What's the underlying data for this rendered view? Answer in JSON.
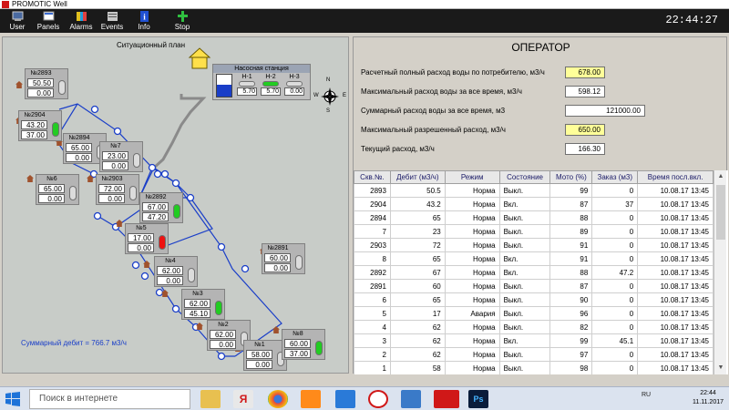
{
  "window": {
    "title": "PROMOTIC Well"
  },
  "toolbar": {
    "buttons": [
      {
        "label": "User",
        "icon": "user-icon"
      },
      {
        "label": "Panels",
        "icon": "panels-icon"
      },
      {
        "label": "Alarms",
        "icon": "alarms-icon"
      },
      {
        "label": "Events",
        "icon": "events-icon"
      },
      {
        "label": "Info",
        "icon": "info-icon"
      },
      {
        "label": "Stop",
        "icon": "stop-icon"
      }
    ],
    "clock": "22:44:27"
  },
  "map": {
    "title": "Ситуационный план",
    "compass": {
      "n": "N",
      "s": "S",
      "e": "E",
      "w": "W"
    },
    "pump_station": {
      "title": "Насосная станция",
      "tank_level": 0.55,
      "tank_value": "5.70",
      "pumps": [
        {
          "name": "Н-1",
          "value": "5.70",
          "on": false
        },
        {
          "name": "Н-2",
          "value": "5.70",
          "on": true
        },
        {
          "name": "Н-3",
          "value": "0.00",
          "on": false
        }
      ]
    },
    "wells": [
      {
        "label": "№2893",
        "debit": "50.50",
        "order": "0.00",
        "state": "off"
      },
      {
        "label": "№2904",
        "debit": "43.20",
        "order": "37.00",
        "state": "on"
      },
      {
        "label": "№2894",
        "debit": "65.00",
        "order": "0.00",
        "state": "off"
      },
      {
        "label": "№7",
        "debit": "23.00",
        "order": "0.00",
        "state": "off"
      },
      {
        "label": "№2903",
        "debit": "72.00",
        "order": "0.00",
        "state": "off"
      },
      {
        "label": "№6",
        "debit": "65.00",
        "order": "0.00",
        "state": "off"
      },
      {
        "label": "№2892",
        "debit": "67.00",
        "order": "47.20",
        "state": "on"
      },
      {
        "label": "№5",
        "debit": "17.00",
        "order": "0.00",
        "state": "alarm"
      },
      {
        "label": "№4",
        "debit": "62.00",
        "order": "0.00",
        "state": "off"
      },
      {
        "label": "№3",
        "debit": "62.00",
        "order": "45.10",
        "state": "on"
      },
      {
        "label": "№2",
        "debit": "62.00",
        "order": "0.00",
        "state": "off"
      },
      {
        "label": "№2891",
        "debit": "60.00",
        "order": "0.00",
        "state": "off"
      },
      {
        "label": "№1",
        "debit": "58.00",
        "order": "0.00",
        "state": "off"
      },
      {
        "label": "№8",
        "debit": "60.00",
        "order": "37.00",
        "state": "on"
      }
    ],
    "summary": "Суммарный дебит = 766.7 м3/ч",
    "colors": {
      "on": "#22cc22",
      "alarm": "#ee1111",
      "off": "#dcdcdc",
      "pipe": "#1a3ec8",
      "valve": "#1a3ec8"
    }
  },
  "operator": {
    "title": "ОПЕРАТОР",
    "rows": [
      {
        "label": "Расчетный полный расход воды по потребителю, м3/ч",
        "value": "678.00",
        "highlight": true
      },
      {
        "label": "Максимальный расход воды за все время, м3/ч",
        "value": "598.12",
        "highlight": false
      },
      {
        "label": "Суммарный расход воды за все время, м3",
        "value": "121000.00",
        "highlight": false
      },
      {
        "label": "Максимальный разрешенный расход, м3/ч",
        "value": "650.00",
        "highlight": true
      },
      {
        "label": "Текущий расход, м3/ч",
        "value": "166.30",
        "highlight": false
      }
    ]
  },
  "table": {
    "headers": [
      "Скв.№.",
      "Дебит (м3/ч)",
      "Режим",
      "Состояние",
      "Мото (%)",
      "Заказ (м3)",
      "Время посл.вкл."
    ],
    "rows": [
      [
        "2893",
        "50.5",
        "Норма",
        "Выкл.",
        "99",
        "0",
        "10.08.17 13:45"
      ],
      [
        "2904",
        "43.2",
        "Норма",
        "Вкл.",
        "87",
        "37",
        "10.08.17 13:45"
      ],
      [
        "2894",
        "65",
        "Норма",
        "Выкл.",
        "88",
        "0",
        "10.08.17 13:45"
      ],
      [
        "7",
        "23",
        "Норма",
        "Выкл.",
        "89",
        "0",
        "10.08.17 13:45"
      ],
      [
        "2903",
        "72",
        "Норма",
        "Выкл.",
        "91",
        "0",
        "10.08.17 13:45"
      ],
      [
        "8",
        "65",
        "Норма",
        "Вкл.",
        "91",
        "0",
        "10.08.17 13:45"
      ],
      [
        "2892",
        "67",
        "Норма",
        "Вкл.",
        "88",
        "47.2",
        "10.08.17 13:45"
      ],
      [
        "2891",
        "60",
        "Норма",
        "Выкл.",
        "87",
        "0",
        "10.08.17 13:45"
      ],
      [
        "6",
        "65",
        "Норма",
        "Выкл.",
        "90",
        "0",
        "10.08.17 13:45"
      ],
      [
        "5",
        "17",
        "Авария",
        "Выкл.",
        "96",
        "0",
        "10.08.17 13:45"
      ],
      [
        "4",
        "62",
        "Норма",
        "Выкл.",
        "82",
        "0",
        "10.08.17 13:45"
      ],
      [
        "3",
        "62",
        "Норма",
        "Вкл.",
        "99",
        "45.1",
        "10.08.17 13:45"
      ],
      [
        "2",
        "62",
        "Норма",
        "Выкл.",
        "97",
        "0",
        "10.08.17 13:45"
      ],
      [
        "1",
        "58",
        "Норма",
        "Выкл.",
        "98",
        "0",
        "10.08.17 13:45"
      ]
    ]
  },
  "taskbar": {
    "search_placeholder": "Поиск в интернете",
    "apps": [
      "file-explorer-icon",
      "yandex-icon",
      "chrome-icon",
      "media-player-icon",
      "edge-icon",
      "yandex-browser-icon",
      "volume-icon",
      "promotic-icon",
      "photoshop-icon"
    ],
    "lang": "RU",
    "time": "22:44",
    "date": "11.11.2017"
  }
}
